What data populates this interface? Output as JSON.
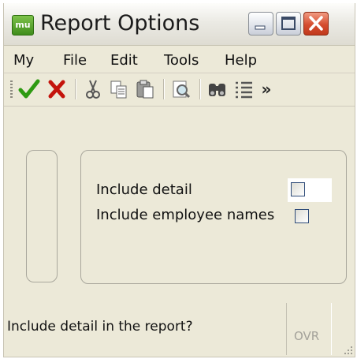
{
  "window": {
    "title": "Report Options",
    "app_icon_text": "mu"
  },
  "menubar": {
    "items": [
      "My",
      "File",
      "Edit",
      "Tools",
      "Help"
    ]
  },
  "toolbar": {
    "items": [
      "ok-check-icon",
      "cancel-x-icon",
      "cut-icon",
      "copy-icon",
      "paste-icon",
      "preview-icon",
      "find-icon",
      "list-icon",
      "overflow-chevron-icon"
    ],
    "overflow_label": "»"
  },
  "form": {
    "include_detail_label": "Include detail",
    "include_detail_checked": false,
    "include_employee_names_label": "Include employee names",
    "include_employee_names_checked": false
  },
  "statusbar": {
    "message": "Include detail in the report?",
    "mode": "OVR"
  },
  "colors": {
    "ok_green": "#2e9a12",
    "cancel_red": "#c4140c",
    "close_button": "#d54d2f",
    "checkbox_border": "#2d4a78"
  }
}
